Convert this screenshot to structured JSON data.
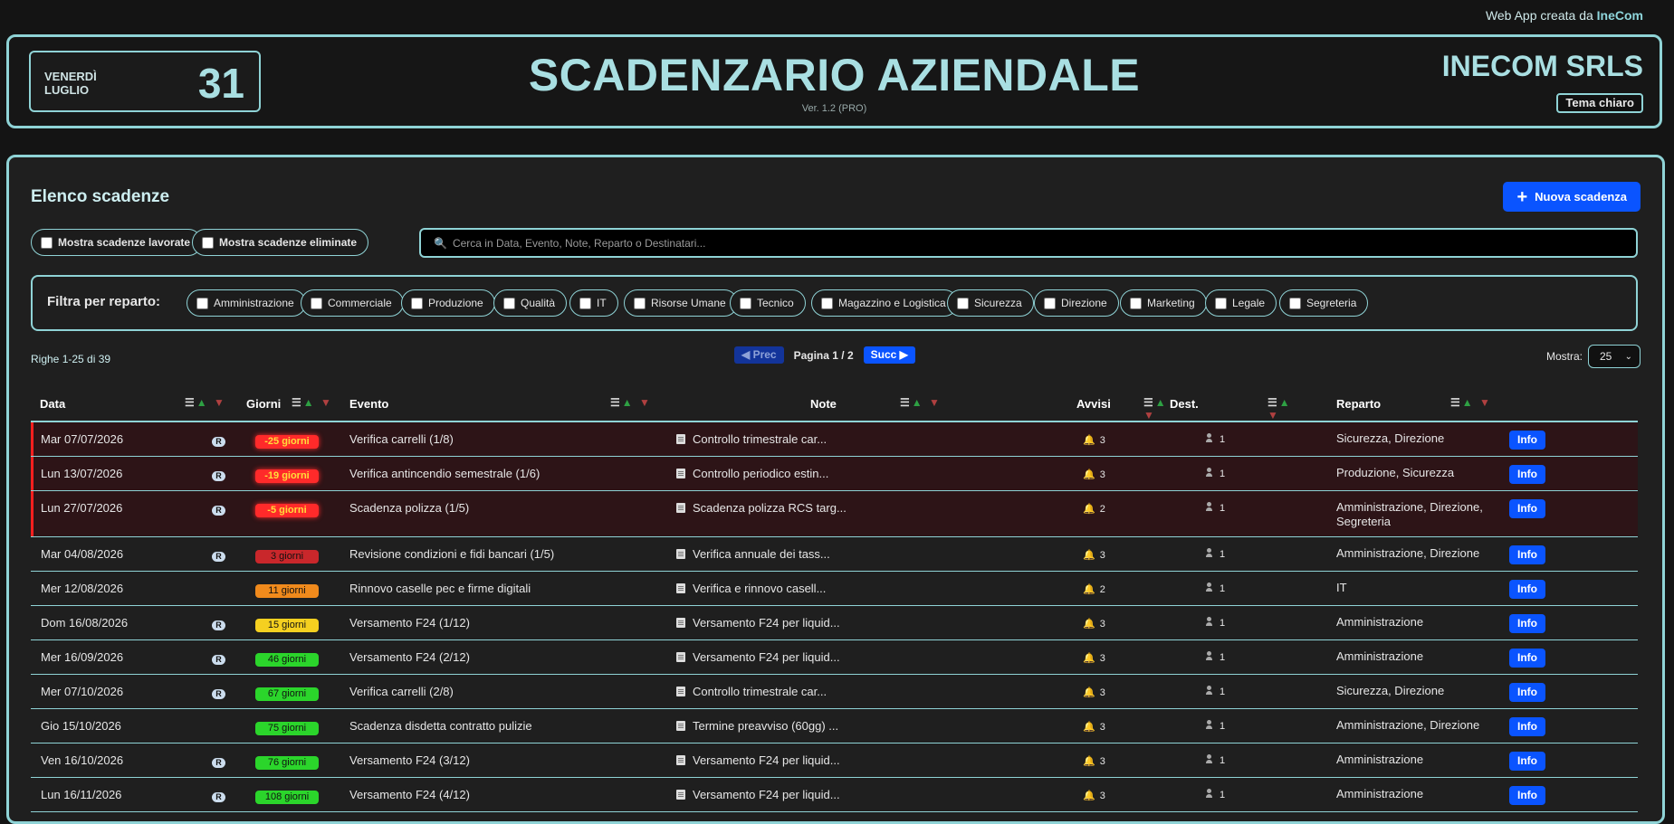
{
  "credit": {
    "prefix": "Web App creata da",
    "brand": "IneCom"
  },
  "header": {
    "weekday": "VENERDÌ",
    "month": "LUGLIO",
    "day": "31",
    "title": "SCADENZARIO AZIENDALE",
    "version": "Ver. 1.2 (PRO)",
    "company": "INECOM SRLS",
    "theme_button": "Tema chiaro"
  },
  "panel": {
    "title": "Elenco scadenze",
    "new_button": "Nuova scadenza",
    "toggle_worked": "Mostra scadenze lavorate",
    "toggle_deleted": "Mostra scadenze eliminate",
    "search_placeholder": "Cerca in Data, Evento, Note, Reparto o Destinatari..."
  },
  "filter": {
    "label": "Filtra per reparto:",
    "departments": [
      "Amministrazione",
      "Commerciale",
      "Produzione",
      "Qualità",
      "IT",
      "Risorse Umane",
      "Tecnico",
      "Magazzino e Logistica",
      "Sicurezza",
      "Direzione",
      "Marketing",
      "Legale",
      "Segreteria"
    ]
  },
  "pagination": {
    "rows_info": "Righe 1-25 di 39",
    "prev": "◀ Prec",
    "page": "Pagina 1 / 2",
    "next": "Succ ▶",
    "show_label": "Mostra:",
    "show_value": "25"
  },
  "table": {
    "headers": {
      "data": "Data",
      "giorni": "Giorni",
      "evento": "Evento",
      "note": "Note",
      "avvisi": "Avvisi",
      "dest": "Dest.",
      "reparto": "Reparto"
    },
    "recurring_badge": "R",
    "info_label": "Info",
    "rows": [
      {
        "date": "Mar 07/07/2026",
        "r": "R",
        "days": "-25 giorni",
        "event": "Verifica carrelli (1/8)",
        "note": "Controllo trimestrale car...",
        "alerts": "3",
        "dest": "1",
        "dept": "Sicurezza, Direzione"
      },
      {
        "date": "Lun 13/07/2026",
        "r": "R",
        "days": "-19 giorni",
        "event": "Verifica antincendio semestrale (1/6)",
        "note": "Controllo periodico estin...",
        "alerts": "3",
        "dest": "1",
        "dept": "Produzione, Sicurezza"
      },
      {
        "date": "Lun 27/07/2026",
        "r": "R",
        "days": "-5 giorni",
        "event": "Scadenza polizza (1/5)",
        "note": "Scadenza polizza RCS targ...",
        "alerts": "2",
        "dest": "1",
        "dept": "Amministrazione, Direzione, Segreteria"
      },
      {
        "date": "Mar 04/08/2026",
        "r": "R",
        "days": "3 giorni",
        "event": "Revisione condizioni e fidi bancari (1/5)",
        "note": "Verifica annuale dei tass...",
        "alerts": "3",
        "dest": "1",
        "dept": "Amministrazione, Direzione"
      },
      {
        "date": "Mer 12/08/2026",
        "r": "",
        "days": "11 giorni",
        "event": "Rinnovo caselle pec e firme digitali",
        "note": "Verifica e rinnovo casell...",
        "alerts": "2",
        "dest": "1",
        "dept": "IT"
      },
      {
        "date": "Dom 16/08/2026",
        "r": "R",
        "days": "15 giorni",
        "event": "Versamento F24 (1/12)",
        "note": "Versamento F24 per liquid...",
        "alerts": "3",
        "dest": "1",
        "dept": "Amministrazione"
      },
      {
        "date": "Mer 16/09/2026",
        "r": "R",
        "days": "46 giorni",
        "event": "Versamento F24 (2/12)",
        "note": "Versamento F24 per liquid...",
        "alerts": "3",
        "dest": "1",
        "dept": "Amministrazione"
      },
      {
        "date": "Mer 07/10/2026",
        "r": "R",
        "days": "67 giorni",
        "event": "Verifica carrelli (2/8)",
        "note": "Controllo trimestrale car...",
        "alerts": "3",
        "dest": "1",
        "dept": "Sicurezza, Direzione"
      },
      {
        "date": "Gio 15/10/2026",
        "r": "",
        "days": "75 giorni",
        "event": "Scadenza disdetta contratto pulizie",
        "note": "Termine preavviso (60gg) ...",
        "alerts": "3",
        "dest": "1",
        "dept": "Amministrazione, Direzione"
      },
      {
        "date": "Ven 16/10/2026",
        "r": "R",
        "days": "76 giorni",
        "event": "Versamento F24 (3/12)",
        "note": "Versamento F24 per liquid...",
        "alerts": "3",
        "dest": "1",
        "dept": "Amministrazione"
      },
      {
        "date": "Lun 16/11/2026",
        "r": "R",
        "days": "108 giorni",
        "event": "Versamento F24 (4/12)",
        "note": "Versamento F24 per liquid...",
        "alerts": "3",
        "dest": "1",
        "dept": "Amministrazione"
      }
    ]
  },
  "colors": {
    "accent": "#8fd3d6",
    "primary_button": "#0a54ff",
    "overdue_row": "#2d1417",
    "overdue_marker": "#ff1f1f"
  }
}
